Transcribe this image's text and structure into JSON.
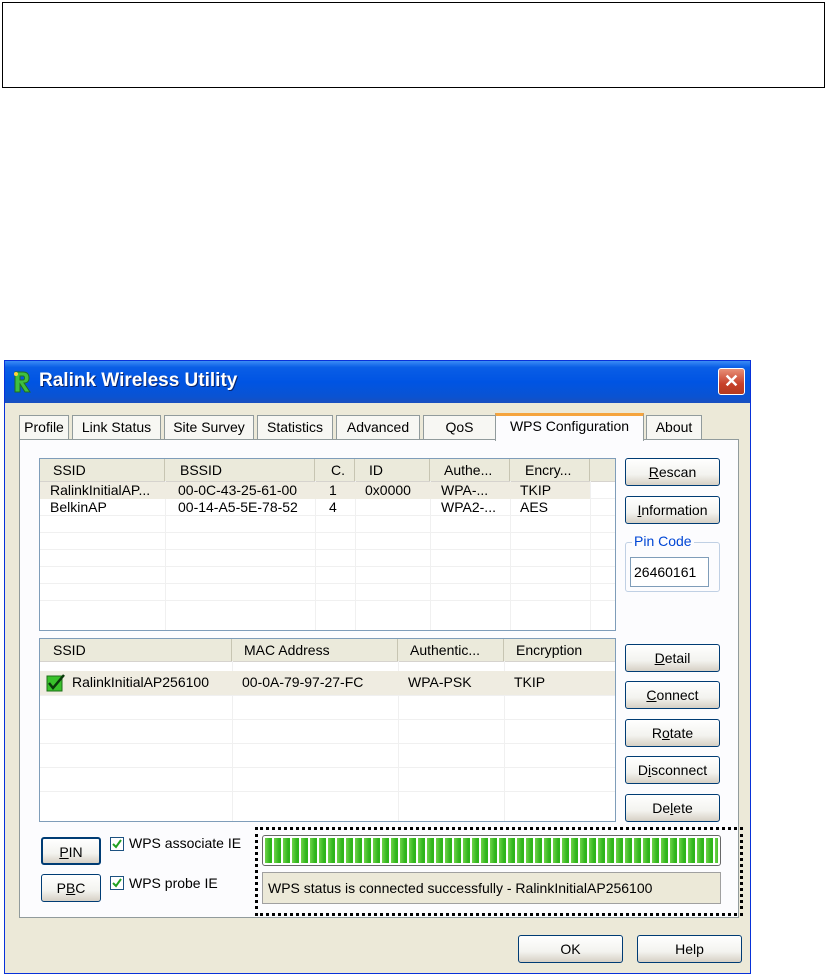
{
  "window": {
    "title": "Ralink Wireless Utility",
    "close_glyph": "✕",
    "app_icon": "ralink-r-icon"
  },
  "tabs": [
    {
      "label": "Profile"
    },
    {
      "label": "Link Status"
    },
    {
      "label": "Site Survey"
    },
    {
      "label": "Statistics"
    },
    {
      "label": "Advanced"
    },
    {
      "label": "QoS"
    },
    {
      "label": "WPS Configuration",
      "active": true
    },
    {
      "label": "About"
    }
  ],
  "ap_list": {
    "columns": [
      "SSID",
      "BSSID",
      "C.",
      "ID",
      "Authe...",
      "Encry..."
    ],
    "rows": [
      [
        "RalinkInitialAP...",
        "00-0C-43-25-61-00",
        "1",
        "0x0000",
        "WPA-...",
        "TKIP"
      ],
      [
        "BelkinAP",
        "00-14-A5-5E-78-52",
        "4",
        "",
        "WPA2-...",
        "AES"
      ]
    ]
  },
  "profile_list": {
    "columns": [
      "SSID",
      "MAC Address",
      "Authentic...",
      "Encryption"
    ],
    "rows": [
      [
        "RalinkInitialAP256100",
        "00-0A-79-97-27-FC",
        "WPA-PSK",
        "TKIP"
      ]
    ]
  },
  "buttons": {
    "rescan": {
      "pre": "",
      "ul": "R",
      "post": "escan"
    },
    "information": {
      "pre": "",
      "ul": "I",
      "post": "nformation"
    },
    "detail": {
      "pre": "",
      "ul": "D",
      "post": "etail"
    },
    "connect": {
      "pre": "",
      "ul": "C",
      "post": "onnect"
    },
    "rotate": {
      "pre": "R",
      "ul": "o",
      "post": "tate"
    },
    "disconnect": {
      "pre": "D",
      "ul": "i",
      "post": "sconnect"
    },
    "delete": {
      "pre": "De",
      "ul": "l",
      "post": "ete"
    },
    "pin": {
      "pre": "",
      "ul": "P",
      "post": "IN"
    },
    "pbc": {
      "pre": "P",
      "ul": "B",
      "post": "C"
    },
    "ok": "OK",
    "help": "Help"
  },
  "pin_code": {
    "label": "Pin Code",
    "value": "26460161"
  },
  "options": {
    "wps_associate_ie": {
      "label": "WPS associate IE",
      "checked": true
    },
    "wps_probe_ie": {
      "label": "WPS probe IE",
      "checked": true
    }
  },
  "wps_progress": {
    "percent": 100
  },
  "wps_status": "WPS status is connected successfully - RalinkInitialAP256100",
  "colors": {
    "titlebar": "#0054e3",
    "progress": "#2fb51b",
    "active_tab_accent": "#f5a43e"
  }
}
